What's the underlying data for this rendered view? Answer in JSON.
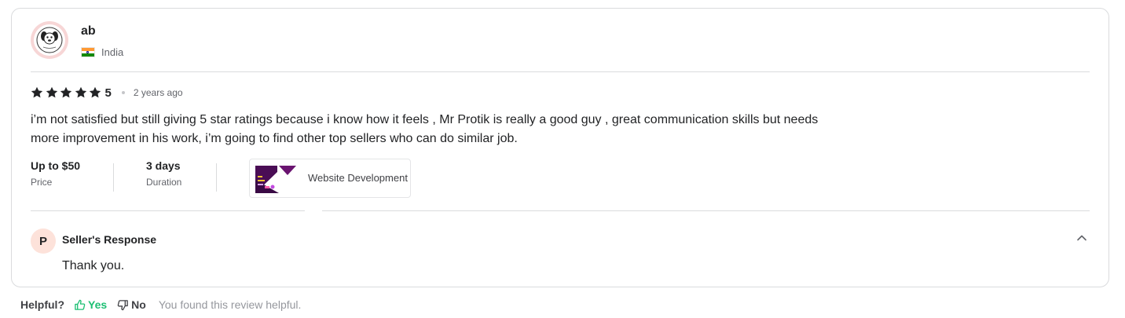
{
  "reviewer": {
    "name": "ab",
    "country": "India",
    "flag_colors": [
      "#ff9933",
      "#ffffff",
      "#138808"
    ]
  },
  "rating": {
    "value": "5",
    "stars": 5,
    "time_ago": "2 years ago"
  },
  "review": {
    "text_line1": "i’m not satisfied but still giving 5 star ratings because i know how it feels , Mr Protik is really a good guy , great communication skills but needs",
    "text_line2": "more improvement in his work, i’m going to find other top sellers who can do similar job."
  },
  "meta": {
    "price_value": "Up to $50",
    "price_label": "Price",
    "duration_value": "3 days",
    "duration_label": "Duration"
  },
  "gig": {
    "title": "Website Development"
  },
  "seller_response": {
    "initial": "P",
    "title": "Seller's Response",
    "message": "Thank you."
  },
  "helpful": {
    "label": "Helpful?",
    "yes_label": "Yes",
    "no_label": "No",
    "feedback": "You found this review helpful."
  },
  "colors": {
    "accent_green": "#1dbf73",
    "star": "#222325",
    "avatar_ring": "#f7d6d6",
    "seller_avatar_bg": "#fde2da"
  }
}
